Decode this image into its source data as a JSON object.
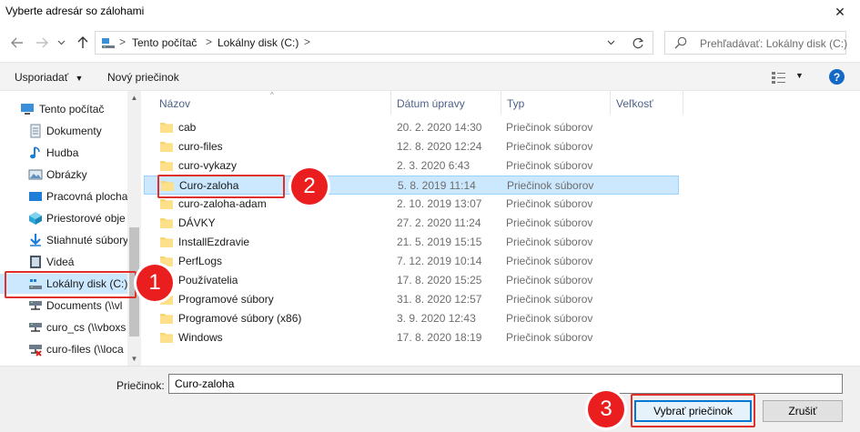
{
  "window": {
    "title": "Vyberte adresár so zálohami",
    "close_glyph": "✕"
  },
  "navigation": {
    "back_icon": "back-arrow-icon",
    "forward_icon": "forward-arrow-icon",
    "recent_icon": "chevron-down-icon",
    "up_icon": "up-arrow-icon"
  },
  "address": {
    "crumbs": [
      "Tento počítač",
      "Lokálny disk (C:)"
    ],
    "separator": ">"
  },
  "search": {
    "placeholder": "Prehľadávať: Lokálny disk (C:)"
  },
  "toolbar": {
    "organize_label": "Usporiadať",
    "new_folder_label": "Nový priečinok",
    "help_label": "?"
  },
  "sidebar": {
    "items": [
      {
        "label": "Tento počítač",
        "icon": "computer-icon"
      },
      {
        "label": "Dokumenty",
        "icon": "documents-icon"
      },
      {
        "label": "Hudba",
        "icon": "music-icon"
      },
      {
        "label": "Obrázky",
        "icon": "pictures-icon"
      },
      {
        "label": "Pracovná plocha",
        "icon": "desktop-icon"
      },
      {
        "label": "Priestorové obje",
        "icon": "3d-objects-icon"
      },
      {
        "label": "Stiahnuté súbory",
        "icon": "downloads-icon"
      },
      {
        "label": "Videá",
        "icon": "videos-icon"
      },
      {
        "label": "Lokálny disk (C:)",
        "icon": "local-disk-icon"
      },
      {
        "label": "Documents (\\\\vl",
        "icon": "network-drive-icon"
      },
      {
        "label": "curo_cs (\\\\vboxs",
        "icon": "network-drive-icon"
      },
      {
        "label": "curo-files (\\\\loca",
        "icon": "network-drive-disconnected-icon"
      }
    ]
  },
  "columns": {
    "name": "Názov",
    "date": "Dátum úpravy",
    "type": "Typ",
    "size": "Veľkosť"
  },
  "files": [
    {
      "name": "cab",
      "date": "20. 2. 2020 14:30",
      "type": "Priečinok súborov"
    },
    {
      "name": "curo-files",
      "date": "12. 8. 2020 12:24",
      "type": "Priečinok súborov"
    },
    {
      "name": "curo-vykazy",
      "date": "2. 3. 2020 6:43",
      "type": "Priečinok súborov"
    },
    {
      "name": "Curo-zaloha",
      "date": "5. 8. 2019 11:14",
      "type": "Priečinok súborov"
    },
    {
      "name": "curo-zaloha-adam",
      "date": "2. 10. 2019 13:07",
      "type": "Priečinok súborov"
    },
    {
      "name": "DÁVKY",
      "date": "27. 2. 2020 11:24",
      "type": "Priečinok súborov"
    },
    {
      "name": "InstallEzdravie",
      "date": "21. 5. 2019 15:15",
      "type": "Priečinok súborov"
    },
    {
      "name": "PerfLogs",
      "date": "7. 12. 2019 10:14",
      "type": "Priečinok súborov"
    },
    {
      "name": "Používatelia",
      "date": "17. 8. 2020 15:25",
      "type": "Priečinok súborov"
    },
    {
      "name": "Programové súbory",
      "date": "31. 8. 2020 12:57",
      "type": "Priečinok súborov"
    },
    {
      "name": "Programové súbory (x86)",
      "date": "3. 9. 2020 12:43",
      "type": "Priečinok súborov"
    },
    {
      "name": "Windows",
      "date": "17. 8. 2020 18:19",
      "type": "Priečinok súborov"
    }
  ],
  "bottom": {
    "folder_label": "Priečinok:",
    "folder_value": "Curo-zaloha",
    "select_button": "Vybrať priečinok",
    "cancel_button": "Zrušiť"
  },
  "annotations": {
    "badge_1": "1",
    "badge_2": "2",
    "badge_3": "3",
    "color": "#ea1e1e"
  },
  "colors": {
    "selection": "#cce8ff",
    "accent": "#0078d7"
  }
}
